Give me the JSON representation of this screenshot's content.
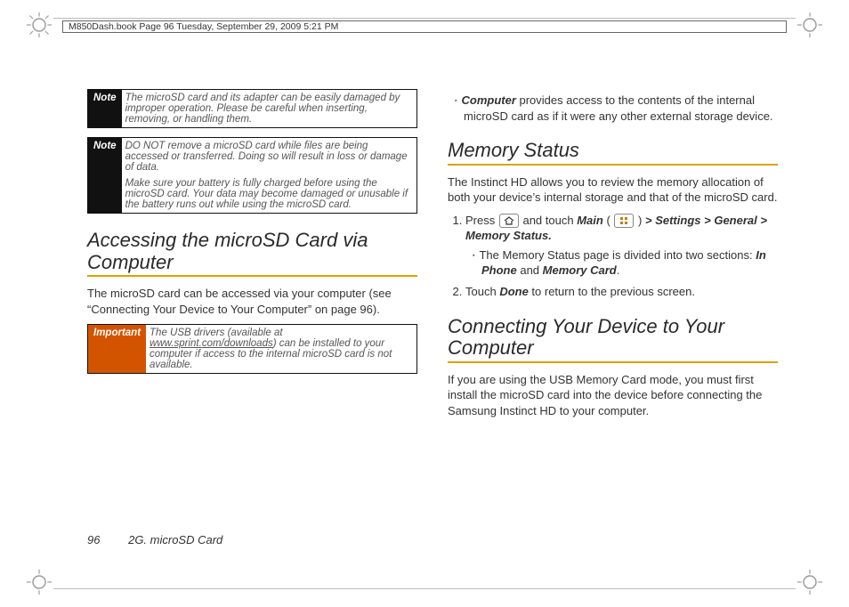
{
  "header": "M850Dash.book  Page 96  Tuesday, September 29, 2009  5:21 PM",
  "col1": {
    "note1": {
      "label": "Note",
      "text": "The microSD card and its adapter can be easily damaged by improper operation. Please be careful when inserting, removing, or handling them."
    },
    "note2": {
      "label": "Note",
      "p1": "DO NOT remove a microSD card while files are being accessed or transferred. Doing so will result in loss or damage of data.",
      "p2": "Make sure your battery is fully charged before using the microSD card. Your data may become damaged or unusable if the battery runs out while using the microSD card."
    },
    "h_access": "Accessing the microSD Card via Computer",
    "p_access": "The microSD card can be accessed via your computer (see “Connecting Your Device to Your Computer” on page 96).",
    "important": {
      "label": "Important",
      "pre": "The USB drivers (available at ",
      "link": "www.sprint.com/downloads",
      "post": ") can be installed to your computer if access to the internal microSD card is not available."
    }
  },
  "col2": {
    "bullet_computer": {
      "bold": "Computer",
      "rest": " provides access to the contents of the internal microSD card as if it were any other external storage device."
    },
    "h_memory": "Memory Status",
    "p_memory": "The Instinct HD allows you to review the memory allocation of both your device’s internal storage and that of the microSD card.",
    "step1": {
      "pre": "Press ",
      "mid1": " and touch ",
      "main_w": "Main",
      "paren_open": " (",
      "paren_close": ") ",
      "gt1": ">",
      "settings_w": " Settings ",
      "gt2": ">",
      "general_w": " General ",
      "gt3": ">",
      "memstat_w": " Memory Status."
    },
    "step1_sub": {
      "pre": "The Memory Status page is divided into two sections: ",
      "inphone": "In Phone",
      "and_w": " and ",
      "memcard": "Memory Card",
      "period": "."
    },
    "step2": {
      "pre": "Touch ",
      "done_w": "Done",
      "post": " to return to the previous screen."
    },
    "h_connect": "Connecting Your Device to Your Computer",
    "p_connect": "If you are using the USB Memory Card mode, you must first install the microSD card into the device before connecting the Samsung Instinct HD to your computer."
  },
  "footer": {
    "page_num": "96",
    "section": "2G. microSD Card"
  }
}
